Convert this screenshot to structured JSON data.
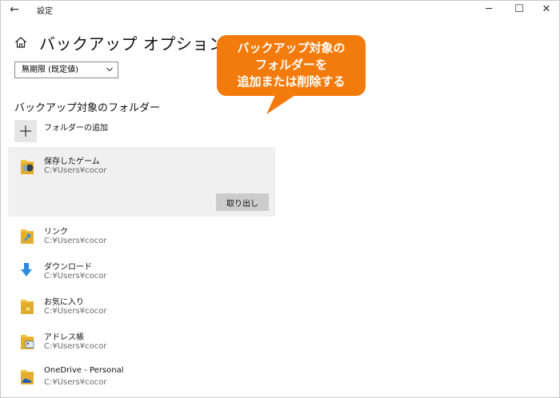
{
  "window": {
    "title": "設定",
    "back_glyph": "←",
    "min_glyph": "─",
    "max_glyph": "☐",
    "close_glyph": "✕"
  },
  "page": {
    "title": "バックアップ オプション"
  },
  "retention_dropdown": {
    "value": "無期限 (既定値)"
  },
  "folders_section": {
    "title": "バックアップ対象のフォルダー",
    "add_label": "フォルダーの追加",
    "remove_label": "取り出し",
    "items": [
      {
        "name": "保存したゲーム",
        "path": "C:¥Users¥cocor",
        "icon": "saved-games-folder-icon",
        "selected": true
      },
      {
        "name": "リンク",
        "path": "C:¥Users¥cocor",
        "icon": "links-folder-icon"
      },
      {
        "name": "ダウンロード",
        "path": "C:¥Users¥cocor",
        "icon": "downloads-folder-icon"
      },
      {
        "name": "お気に入り",
        "path": "C:¥Users¥cocor",
        "icon": "favorites-folder-icon"
      },
      {
        "name": "アドレス帳",
        "path": "C:¥Users¥cocor",
        "icon": "contacts-folder-icon"
      },
      {
        "name": "OneDrive - Personal",
        "path": "C:¥Users¥cocor",
        "icon": "onedrive-folder-icon"
      }
    ]
  },
  "callout": {
    "line1": "バックアップ対象の",
    "line2": "フォルダーを",
    "line3": "追加または削除する",
    "color": "#f37b0c"
  },
  "colors": {
    "selected_bg": "#f0f0f0",
    "button_bg": "#cccccc",
    "folder_yellow": "#f3c444",
    "download_blue": "#2b8ce0"
  }
}
